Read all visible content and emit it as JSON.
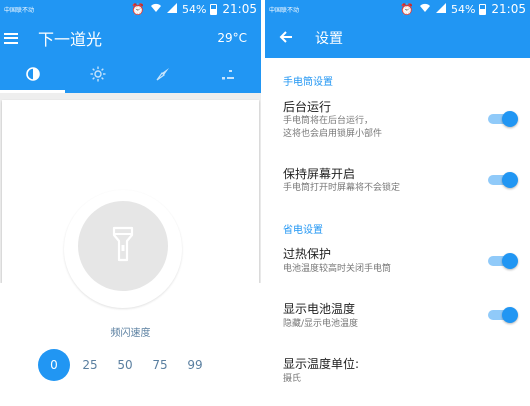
{
  "status": {
    "carrier": "中国联不动",
    "battery": "54%",
    "time": "21:05"
  },
  "left": {
    "app_title": "下一道光",
    "temperature": "29°C",
    "tabs": [
      {
        "icon": "flashlight-mode-icon"
      },
      {
        "icon": "brightness-icon"
      },
      {
        "icon": "compass-icon"
      },
      {
        "icon": "more-icon"
      }
    ],
    "flash_speed_label": "频闪速度",
    "flash_speeds": [
      "0",
      "25",
      "50",
      "75",
      "99"
    ],
    "selected_speed": "0"
  },
  "right": {
    "title": "设置",
    "sections": {
      "flashlight": "手电筒设置",
      "power": "省电设置"
    },
    "items": {
      "background": {
        "title": "后台运行",
        "line1": "手电筒将在后台运行，",
        "line2": "这将也会启用锁屏小部件",
        "on": true
      },
      "screen_on": {
        "title": "保持屏幕开启",
        "subtitle": "手电筒打开时屏幕将不会锁定",
        "on": true
      },
      "overheat": {
        "title": "过热保护",
        "subtitle": "电池温度较高时关闭手电筒",
        "on": true
      },
      "battery_temp": {
        "title": "显示电池温度",
        "subtitle": "隐藏/显示电池温度",
        "on": true
      },
      "temp_unit": {
        "title": "显示温度单位:",
        "subtitle": "摄氏"
      }
    }
  },
  "colors": {
    "primary": "#2196f3",
    "switch_track": "#90caf9"
  }
}
